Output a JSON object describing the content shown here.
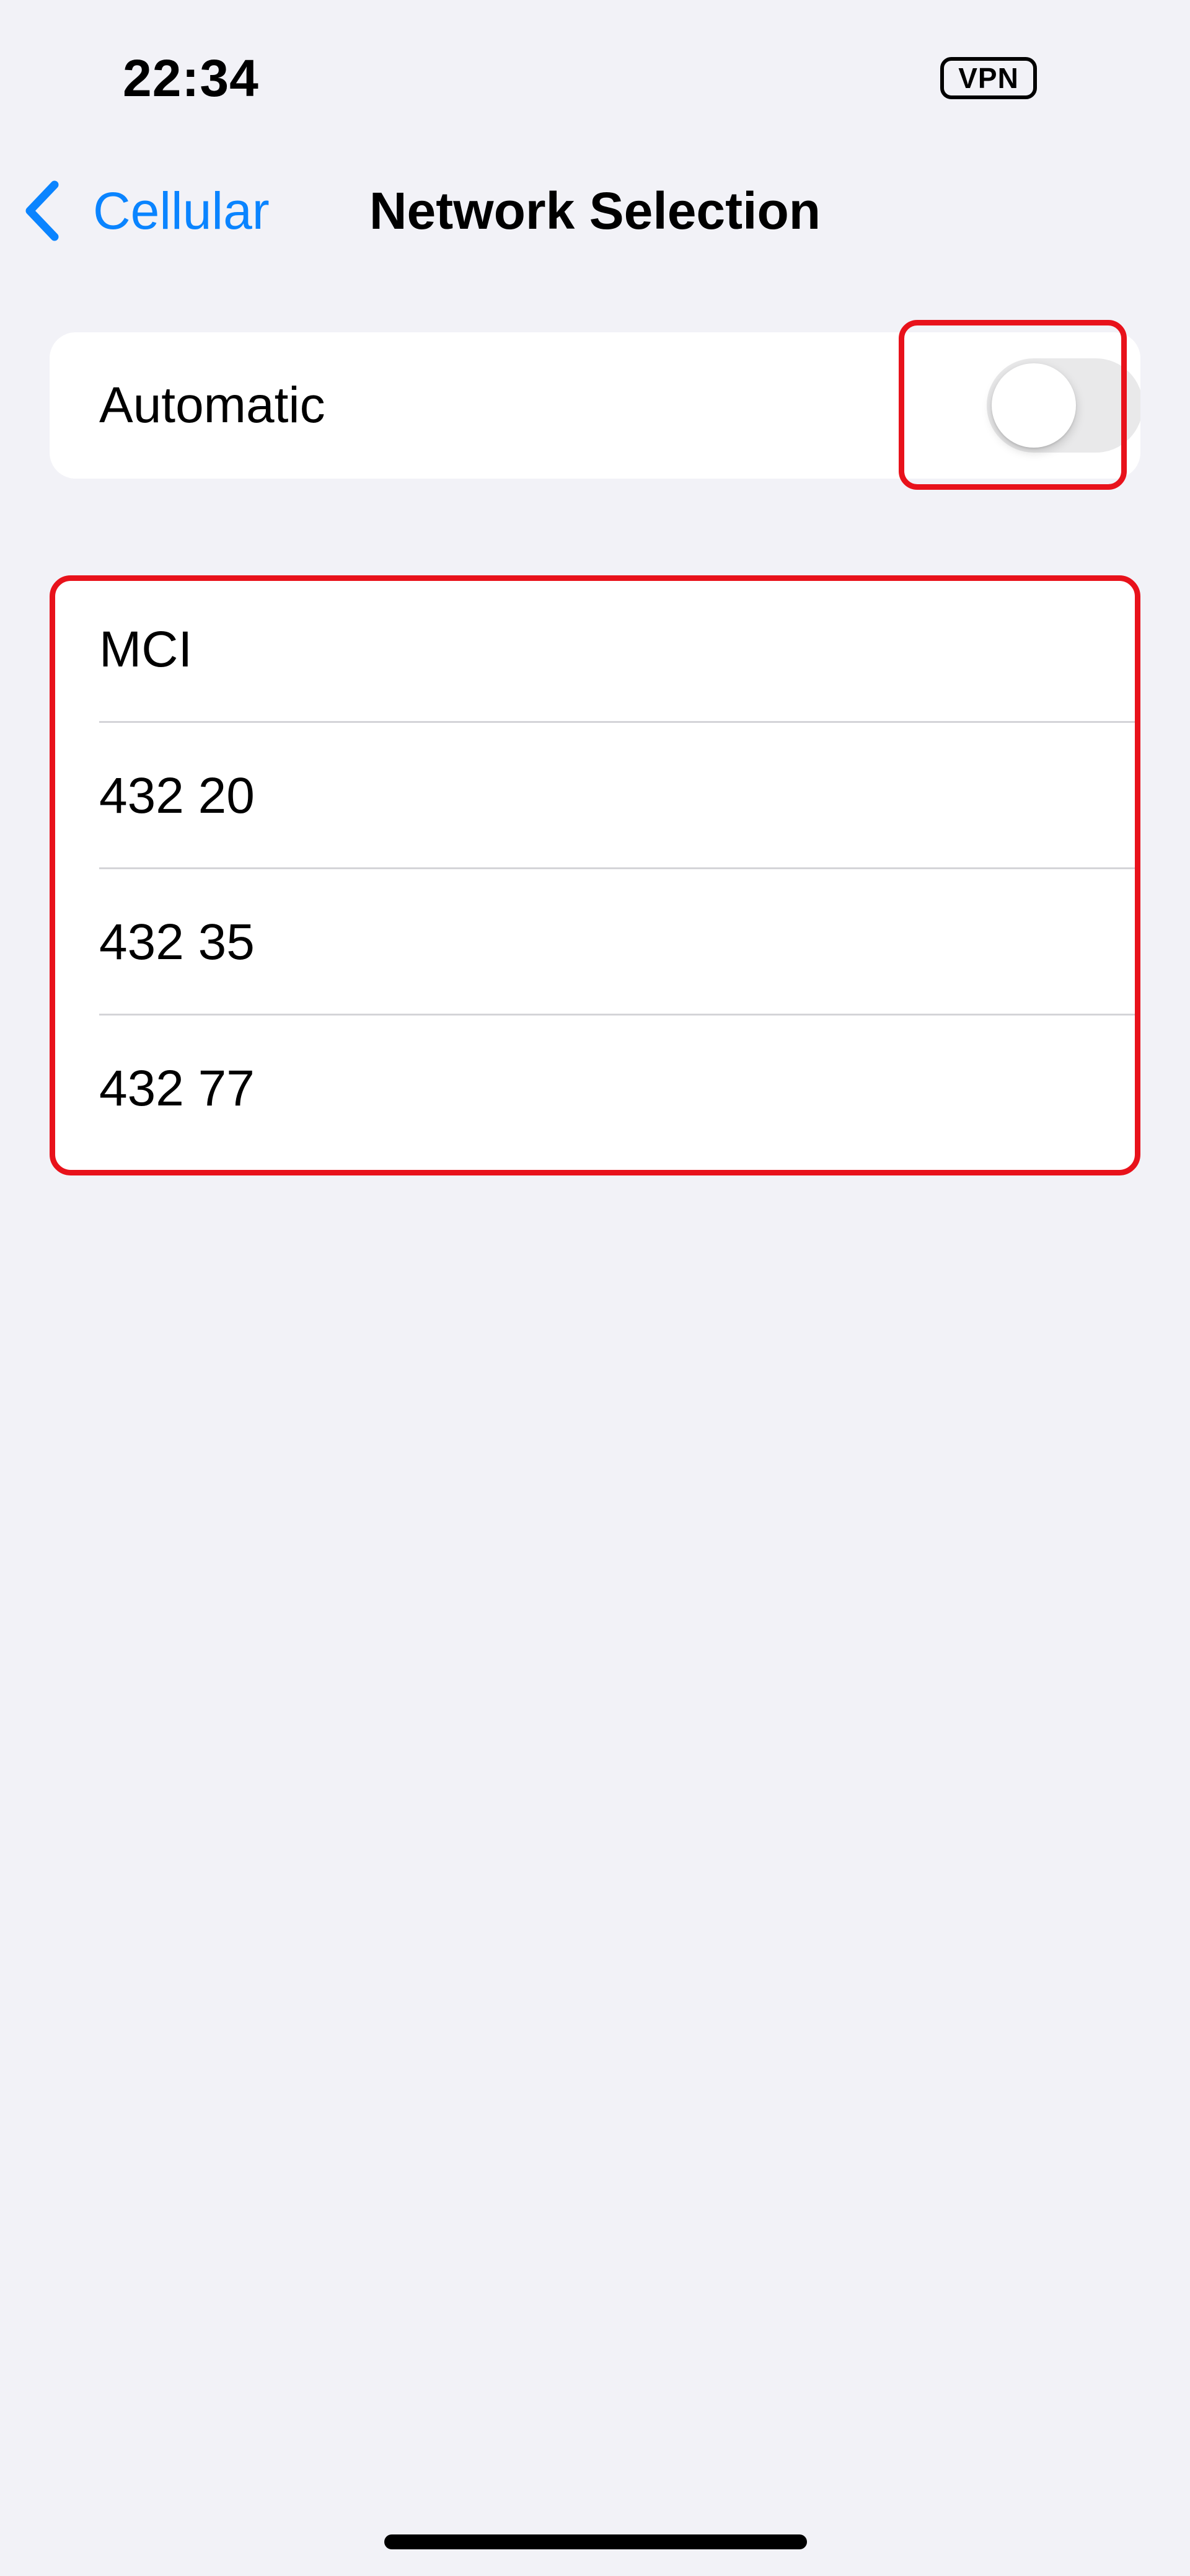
{
  "status_bar": {
    "time": "22:34",
    "vpn_label": "VPN"
  },
  "nav": {
    "back_label": "Cellular",
    "back_icon": "chevron-left-icon",
    "title": "Network Selection"
  },
  "automatic": {
    "label": "Automatic",
    "toggle_on": false
  },
  "networks": [
    {
      "label": "MCI"
    },
    {
      "label": "432 20"
    },
    {
      "label": "432 35"
    },
    {
      "label": "432 77"
    }
  ],
  "colors": {
    "accent": "#0a84ff",
    "highlight": "#e8121b",
    "background": "#f2f2f7",
    "toggle_off_track": "#e9e9ea"
  }
}
